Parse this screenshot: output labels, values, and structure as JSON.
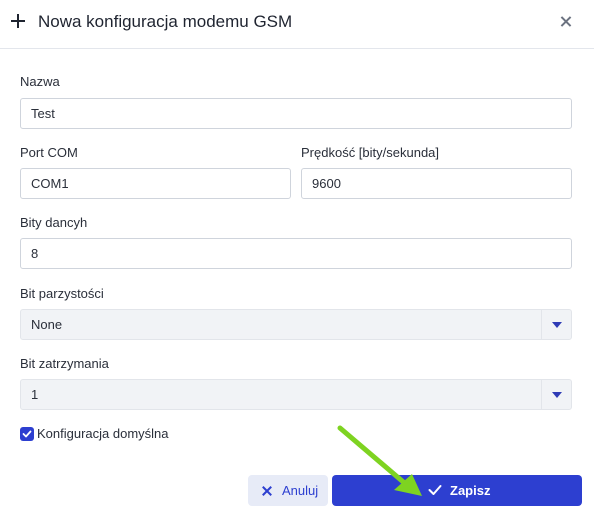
{
  "header": {
    "icon": "plus-icon",
    "title": "Nowa konfiguracja modemu GSM",
    "close_icon": "close-icon"
  },
  "form": {
    "name": {
      "label": "Nazwa",
      "value": "Test"
    },
    "port_com": {
      "label": "Port COM",
      "value": "COM1"
    },
    "speed": {
      "label": "Prędkość [bity/sekunda]",
      "value": "9600"
    },
    "data_bits": {
      "label": "Bity dancyh",
      "value": "8"
    },
    "parity_bit": {
      "label": "Bit parzystości",
      "value": "None"
    },
    "stop_bit": {
      "label": "Bit zatrzymania",
      "value": "1"
    },
    "default_config": {
      "label": "Konfiguracja domyślna",
      "checked": true
    }
  },
  "footer": {
    "cancel_label": "Anuluj",
    "cancel_icon": "x-icon",
    "save_label": "Zapisz",
    "save_icon": "check-icon"
  },
  "colors": {
    "primary": "#2d3fd0",
    "cancel_bg": "#e7ebf7",
    "pointer_arrow": "#7ed321"
  }
}
